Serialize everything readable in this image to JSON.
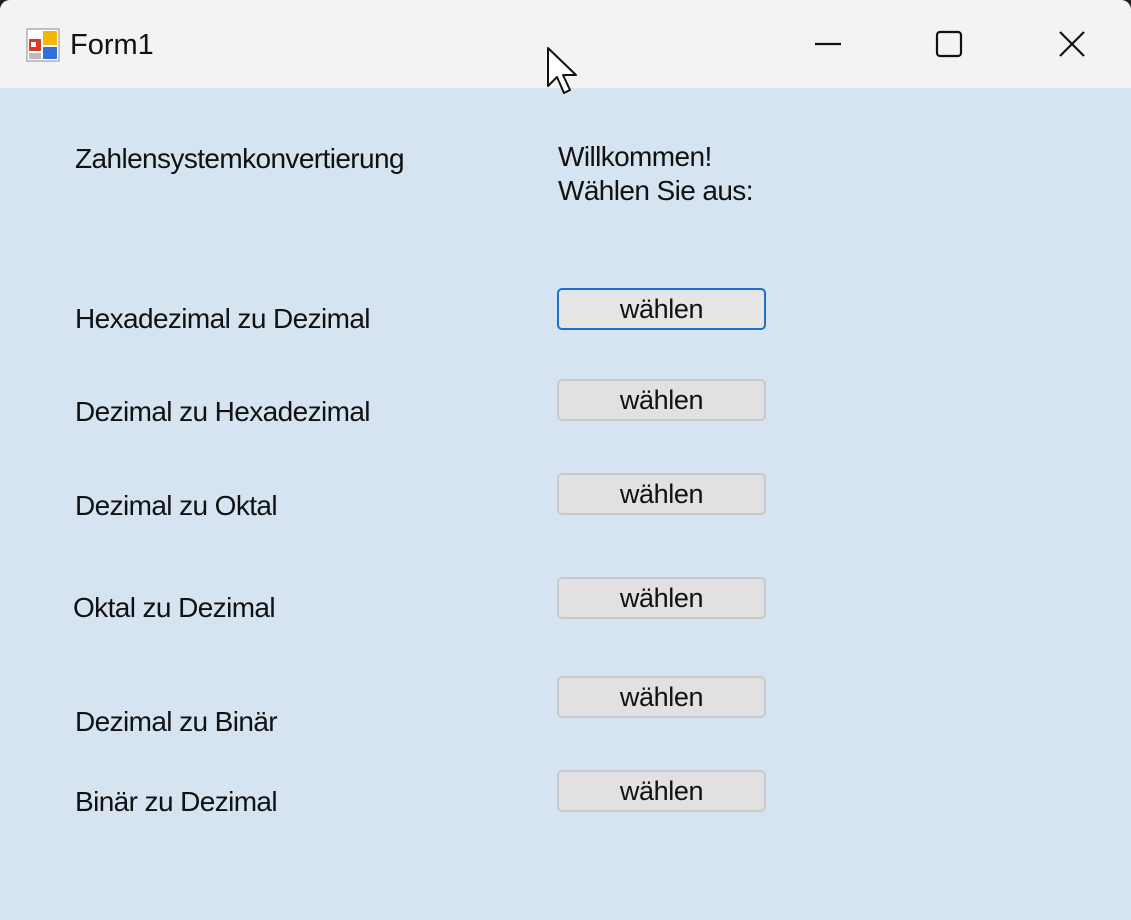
{
  "window": {
    "title": "Form1",
    "app_icon": "winforms-app-icon",
    "controls": {
      "minimize_icon": "minimize-icon",
      "maximize_icon": "maximize-icon",
      "close_icon": "close-icon"
    }
  },
  "form": {
    "heading": "Zahlensystemkonvertierung",
    "welcome_line1": "Willkommen!",
    "welcome_line2": "Wählen Sie aus:",
    "options": [
      {
        "label": "Hexadezimal zu Dezimal",
        "button": "wählen",
        "focused": true
      },
      {
        "label": "Dezimal zu Hexadezimal",
        "button": "wählen",
        "focused": false
      },
      {
        "label": "Dezimal zu Oktal",
        "button": "wählen",
        "focused": false
      },
      {
        "label": "Oktal zu Dezimal",
        "button": "wählen",
        "focused": false
      },
      {
        "label": "Dezimal zu Binär",
        "button": "wählen",
        "focused": false
      },
      {
        "label": "Binär zu Dezimal",
        "button": "wählen",
        "focused": false
      }
    ]
  },
  "colors": {
    "form_background": "#d6e3f1",
    "titlebar_background": "#f3f3f3",
    "button_background": "#e1e1e1",
    "focus_border": "#1c6fd1"
  }
}
